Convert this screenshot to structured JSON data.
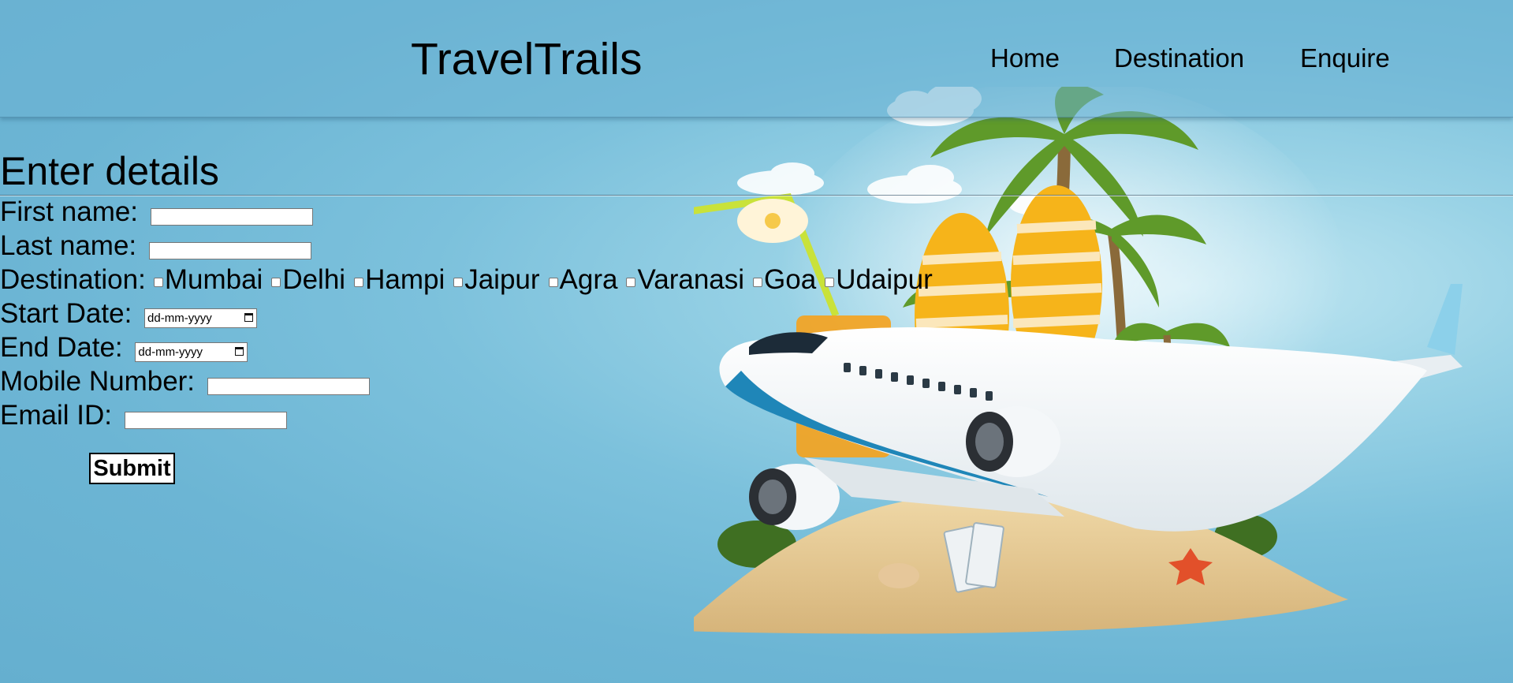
{
  "header": {
    "brand": "TravelTrails",
    "nav": [
      {
        "label": "Home"
      },
      {
        "label": "Destination"
      },
      {
        "label": "Enquire"
      }
    ]
  },
  "form": {
    "title": "Enter details",
    "first_name_label": "First name:",
    "first_name_value": "",
    "last_name_label": "Last name:",
    "last_name_value": "",
    "destination_label": "Destination:",
    "destinations": [
      {
        "label": "Mumbai",
        "checked": false
      },
      {
        "label": "Delhi",
        "checked": false
      },
      {
        "label": "Hampi",
        "checked": false
      },
      {
        "label": "Jaipur",
        "checked": false
      },
      {
        "label": "Agra",
        "checked": false
      },
      {
        "label": "Varanasi",
        "checked": false
      },
      {
        "label": "Goa",
        "checked": false
      },
      {
        "label": "Udaipur",
        "checked": false
      }
    ],
    "start_date_label": "Start Date:",
    "start_date_placeholder": "dd-mm-yyyy",
    "end_date_label": "End Date:",
    "end_date_placeholder": "dd-mm-yyyy",
    "mobile_label": "Mobile Number:",
    "mobile_value": "",
    "email_label": "Email ID:",
    "email_value": "",
    "submit_label": "Submit"
  },
  "icons": {
    "calendar": "calendar-icon"
  },
  "colors": {
    "background": "#6cb5d4",
    "header_background": "#6cb2d4"
  }
}
